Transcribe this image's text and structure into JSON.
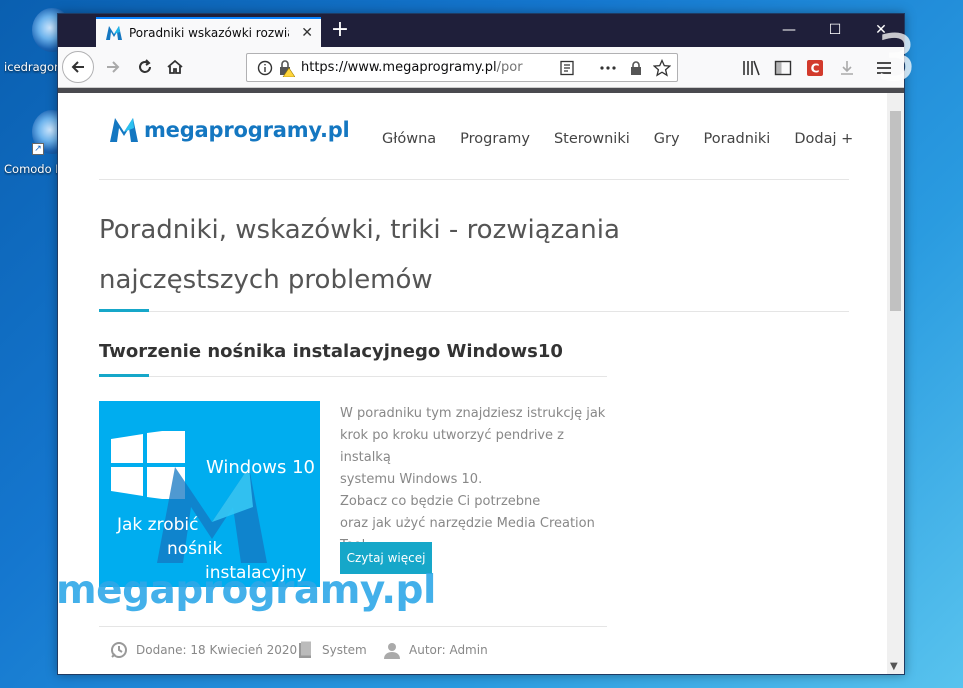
{
  "desktop": {
    "icons": [
      {
        "label": "icedragon",
        "icon": "icedragon-icon"
      },
      {
        "label": "Comodo D",
        "icon": "comodo-dragon-icon"
      }
    ]
  },
  "browser": {
    "tab": {
      "title": "Poradniki wskazówki rozwiązan"
    },
    "url": {
      "main": "https://www.megaprogramy.pl",
      "rest": "/porad"
    },
    "colors": {
      "titlebar": "#1f1f3a",
      "accent": "#0a84ff"
    }
  },
  "page": {
    "logo_text": "megaprogramy.pl",
    "nav": [
      "Główna",
      "Programy",
      "Sterowniki",
      "Gry",
      "Poradniki",
      "Dodaj +"
    ],
    "title": "Poradniki, wskazówki, triki - rozwiązania najczęstszych problemów",
    "post": {
      "title": "Tworzenie nośnika instalacyjnego Windows10",
      "thumb": {
        "line1": "Windows 10",
        "line2": "Jak zrobić",
        "line3": "nośnik",
        "line4": "instalacyjny"
      },
      "excerpt": [
        "W poradniku tym znajdziesz istrukcję jak",
        "krok po kroku utworzyć pendrive z instalką",
        "systemu Windows 10.",
        "Zobacz co będzie Ci potrzebne",
        "oraz jak użyć narzędzie Media Creation",
        "Tool..."
      ],
      "read_more": "Czytaj więcej",
      "date": "Dodane: 18 Kwiecień 2020",
      "category": "System",
      "author": "Autor: Admin"
    },
    "accent_color": "#16a7c9"
  },
  "overlay": {
    "watermark": "megaprogramy.pl",
    "corner_number": "3"
  }
}
